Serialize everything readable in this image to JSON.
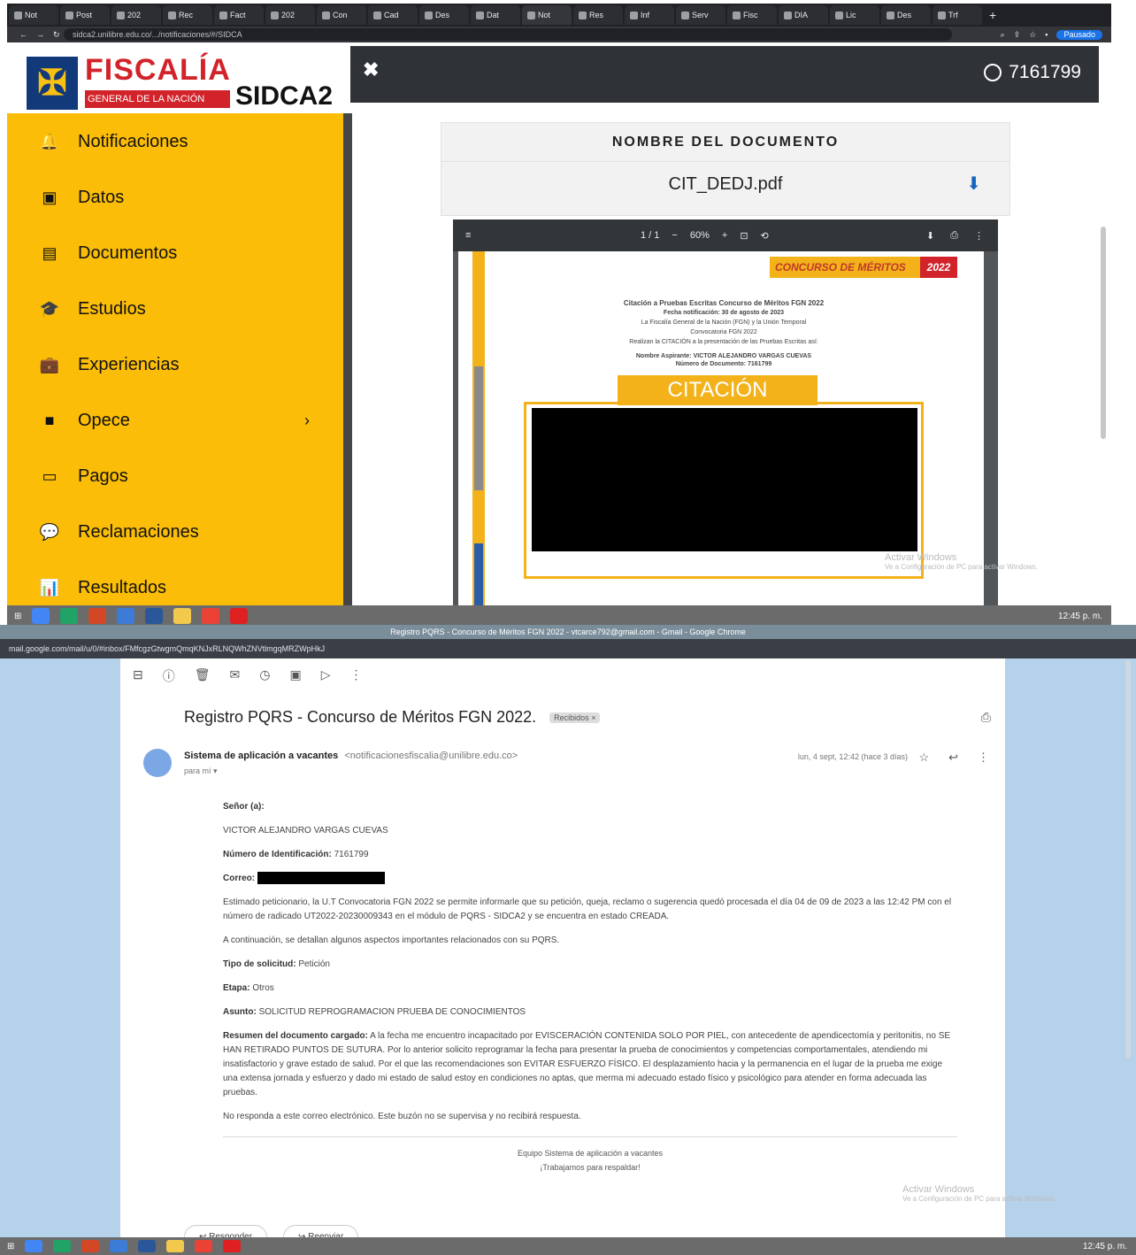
{
  "browser_top": {
    "tabs": [
      "Not",
      "Post",
      "202",
      "Rec",
      "Fact",
      "202",
      "Con",
      "Cad",
      "Des",
      "Dat",
      "Not",
      "Res",
      "Inf",
      "Serv",
      "Fisc",
      "DIA",
      "Lic",
      "Des",
      "Trf"
    ],
    "url": "sidca2.unilibre.edu.co/.../notificaciones/#/SIDCA",
    "profile_label": "Pausado"
  },
  "logo": {
    "symbol": "✠",
    "brand": "FISCALÍA",
    "tagline": "GENERAL DE LA NACIÓN",
    "product": "SIDCA2"
  },
  "header": {
    "close_icon": "close-icon",
    "user_id": "7161799"
  },
  "sidebar": {
    "items": [
      {
        "icon": "bell-icon",
        "glyph": "🔔",
        "label": "Notificaciones"
      },
      {
        "icon": "id-card-icon",
        "glyph": "▣",
        "label": "Datos"
      },
      {
        "icon": "documents-icon",
        "glyph": "▤",
        "label": "Documentos"
      },
      {
        "icon": "graduation-cap-icon",
        "glyph": "🎓",
        "label": "Estudios"
      },
      {
        "icon": "briefcase-icon",
        "glyph": "💼",
        "label": "Experiencias"
      },
      {
        "icon": "folder-icon",
        "glyph": "■",
        "label": "Opece",
        "chevron": "›"
      },
      {
        "icon": "credit-card-icon",
        "glyph": "▭",
        "label": "Pagos"
      },
      {
        "icon": "chat-icon",
        "glyph": "💬",
        "label": "Reclamaciones"
      },
      {
        "icon": "bar-chart-icon",
        "glyph": "📊",
        "label": "Resultados"
      }
    ]
  },
  "document": {
    "heading": "NOMBRE DEL DOCUMENTO",
    "filename": "CIT_DEDJ.pdf",
    "download_glyph": "⬇"
  },
  "pdf_viewer": {
    "menu_glyph": "≡",
    "page_indicator": "1 / 1",
    "minus": "−",
    "zoom": "60%",
    "plus": "+",
    "fit_glyph": "⊡",
    "rotate_glyph": "⟲",
    "download_glyph": "⬇",
    "print_glyph": "⎙",
    "more_glyph": "⋮",
    "badge": "CONCURSO DE MÉRITOS",
    "badge_year": "2022",
    "lines": [
      "Citación a Pruebas Escritas Concurso de Méritos FGN 2022",
      "Fecha notificación: 30 de agosto de 2023",
      "La Fiscalía General de la Nación (FGN) y la Unión Temporal",
      "Convocatoria FGN 2022",
      "Realizan la CITACIÓN a la presentación de las Pruebas Escritas así:",
      "Nombre Aspirante: VICTOR ALEJANDRO VARGAS CUEVAS",
      "Número de Documento: 7161799"
    ],
    "citacion": "CITACIÓN"
  },
  "watermark": {
    "line1": "Activar Windows",
    "line2": "Ve a Configuración de PC para activar Windows."
  },
  "gmail": {
    "window_title": "Registro PQRS - Concurso de Méritos FGN 2022 - vtcarce792@gmail.com - Gmail - Google Chrome",
    "url": "mail.google.com/mail/u/0/#inbox/FMfcgzGtwgmQmqKNJxRLNQWhZNVtlmgqMRZWpHkJ",
    "toolbar_glyphs": [
      "⊟",
      "ⓘ",
      "🗑",
      "✉",
      "◷",
      "▣",
      "▷",
      "⋮"
    ],
    "subject": "Registro PQRS - Concurso de Méritos FGN 2022.",
    "label": "Recibidos ×",
    "print_glyph": "⎙",
    "sender_name": "Sistema de aplicación a vacantes",
    "sender_email": "<notificacionesfiscalia@unilibre.edu.co>",
    "to": "para mí ▾",
    "date": "lun, 4 sept, 12:42 (hace 3 días)",
    "star": "☆",
    "reply_glyph": "↩",
    "more_glyph": "⋮",
    "greeting": "Señor (a):",
    "name": "VICTOR ALEJANDRO VARGAS CUEVAS",
    "id_label": "Número de Identificación:",
    "id_value": "7161799",
    "mail_label": "Correo:",
    "para1": "Estimado peticionario, la U.T Convocatoria FGN 2022 se permite informarle que su petición, queja, reclamo o sugerencia quedó procesada el día 04 de 09 de 2023 a las 12:42 PM con el número de radicado UT2022-20230009343 en el módulo de PQRS - SIDCA2 y se encuentra en estado CREADA.",
    "para2": "A continuación, se detallan algunos aspectos importantes relacionados con su PQRS.",
    "type_label": "Tipo de solicitud:",
    "type_value": "Petición",
    "stage_label": "Etapa:",
    "stage_value": "Otros",
    "subject_label": "Asunto:",
    "subject_value": "SOLICITUD REPROGRAMACION PRUEBA DE CONOCIMIENTOS",
    "summary_label": "Resumen del documento cargado:",
    "summary_value": "A la fecha me encuentro incapacitado por EVISCERACIÓN CONTENIDA SOLO POR PIEL, con antecedente de apendicectomía y peritonitis, no SE HAN RETIRADO PUNTOS DE SUTURA. Por lo anterior solicito reprogramar la fecha para presentar la prueba de conocimientos y competencias comportamentales, atendiendo mi insatisfactorio y grave estado de salud. Por el que las recomendaciones son EVITAR ESFUERZO FÍSICO. El desplazamiento hacia y la permanencia en el lugar de la prueba me exige una extensa jornada y esfuerzo y dado mi estado de salud estoy en condiciones no aptas, que merma mi adecuado estado físico y psicológico para atender en forma adecuada las pruebas.",
    "noreply": "No responda a este correo electrónico. Este buzón no se supervisa y no recibirá respuesta.",
    "footer1": "Equipo Sistema de aplicación a vacantes",
    "footer2": "¡Trabajamos para respaldar!",
    "reply_button": "↩  Responder",
    "forward_button": "↪  Reenviar"
  },
  "taskbar": {
    "time_top": "12:45 p. m.",
    "time_bottom": "12:45 p. m."
  }
}
